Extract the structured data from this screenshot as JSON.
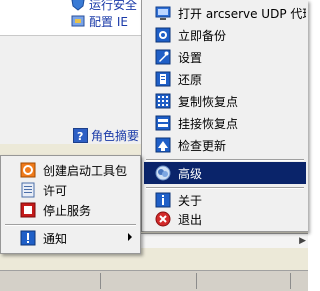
{
  "background": {
    "link1": "运行安全",
    "link2": "配置 IE",
    "role_link": "角色摘要"
  },
  "main_menu": {
    "items": [
      {
        "name": "open-udp-agent",
        "label": "打开 arcserve UDP 代理",
        "icon": "monitor-icon"
      },
      {
        "name": "backup-now",
        "label": "立即备份",
        "icon": "backup-icon"
      },
      {
        "name": "settings",
        "label": "设置",
        "icon": "settings-icon"
      },
      {
        "name": "restore",
        "label": "还原",
        "icon": "restore-icon"
      },
      {
        "name": "copy-recovery-point",
        "label": "复制恢复点",
        "icon": "copy-grid-icon"
      },
      {
        "name": "mount-recovery-point",
        "label": "挂接恢复点",
        "icon": "mount-icon"
      },
      {
        "name": "check-updates",
        "label": "检查更新",
        "icon": "update-icon"
      }
    ],
    "advanced": {
      "label": "高级",
      "icon": "advanced-icon"
    },
    "about": {
      "label": "关于",
      "icon": "info-icon"
    },
    "exit": {
      "label": "退出",
      "icon": "close-icon"
    }
  },
  "sub_menu": {
    "items": [
      {
        "name": "create-boot-kit",
        "label": "创建启动工具包",
        "icon": "bootkit-icon"
      },
      {
        "name": "license",
        "label": "许可",
        "icon": "license-icon"
      },
      {
        "name": "stop-service",
        "label": "停止服务",
        "icon": "stop-icon"
      }
    ],
    "notify": {
      "label": "通知",
      "icon": "notify-icon"
    }
  },
  "colors": {
    "highlight": "#0a246a",
    "menu_bg": "#f0f0f0"
  }
}
